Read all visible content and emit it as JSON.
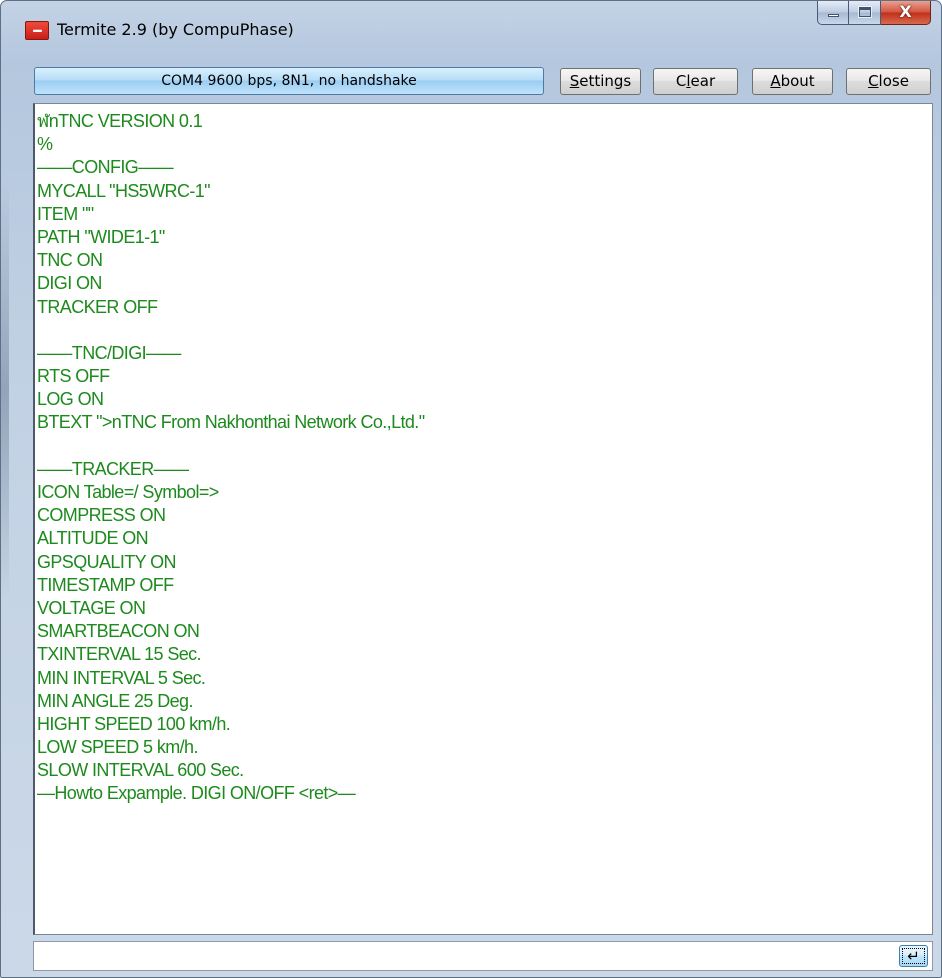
{
  "window": {
    "title": "Termite 2.9 (by CompuPhase)",
    "icon": "termite-app-icon",
    "caption_buttons": [
      "minimize-icon",
      "maximize-icon",
      "close-icon"
    ]
  },
  "toolbar": {
    "status": "COM4 9600 bps, 8N1, no handshake",
    "settings_label": {
      "pre": "",
      "key": "S",
      "post": "ettings"
    },
    "clear_label": {
      "pre": "C",
      "key": "l",
      "post": "ear"
    },
    "about_label": {
      "pre": "",
      "key": "A",
      "post": "bout"
    },
    "close_label": {
      "pre": "",
      "key": "C",
      "post": "lose"
    }
  },
  "terminal": {
    "text_color": "#1d8a1d",
    "lines": [
      "ฬnTNC VERSION 0.1",
      "%",
      "——CONFIG——",
      "MYCALL \"HS5WRC-1\"",
      "ITEM \"\"",
      "PATH \"WIDE1-1\"",
      "TNC ON",
      "DIGI ON",
      "TRACKER OFF",
      "",
      "——TNC/DIGI——",
      "RTS OFF",
      "LOG ON",
      "BTEXT \">nTNC From Nakhonthai Network Co.,Ltd.\"",
      "",
      "——TRACKER——",
      "ICON Table=/ Symbol=>",
      "COMPRESS ON",
      "ALTITUDE ON",
      "GPSQUALITY ON",
      "TIMESTAMP OFF",
      "VOLTAGE ON",
      "SMARTBEACON ON",
      "TXINTERVAL 15 Sec.",
      "MIN INTERVAL 5 Sec.",
      "MIN ANGLE 25 Deg.",
      "HIGHT SPEED 100 km/h.",
      "LOW SPEED 5 km/h.",
      "SLOW INTERVAL 600 Sec.",
      "—Howto Expample. DIGI ON/OFF <ret>—"
    ]
  },
  "input": {
    "value": "",
    "send_icon": "enter-return-icon"
  }
}
